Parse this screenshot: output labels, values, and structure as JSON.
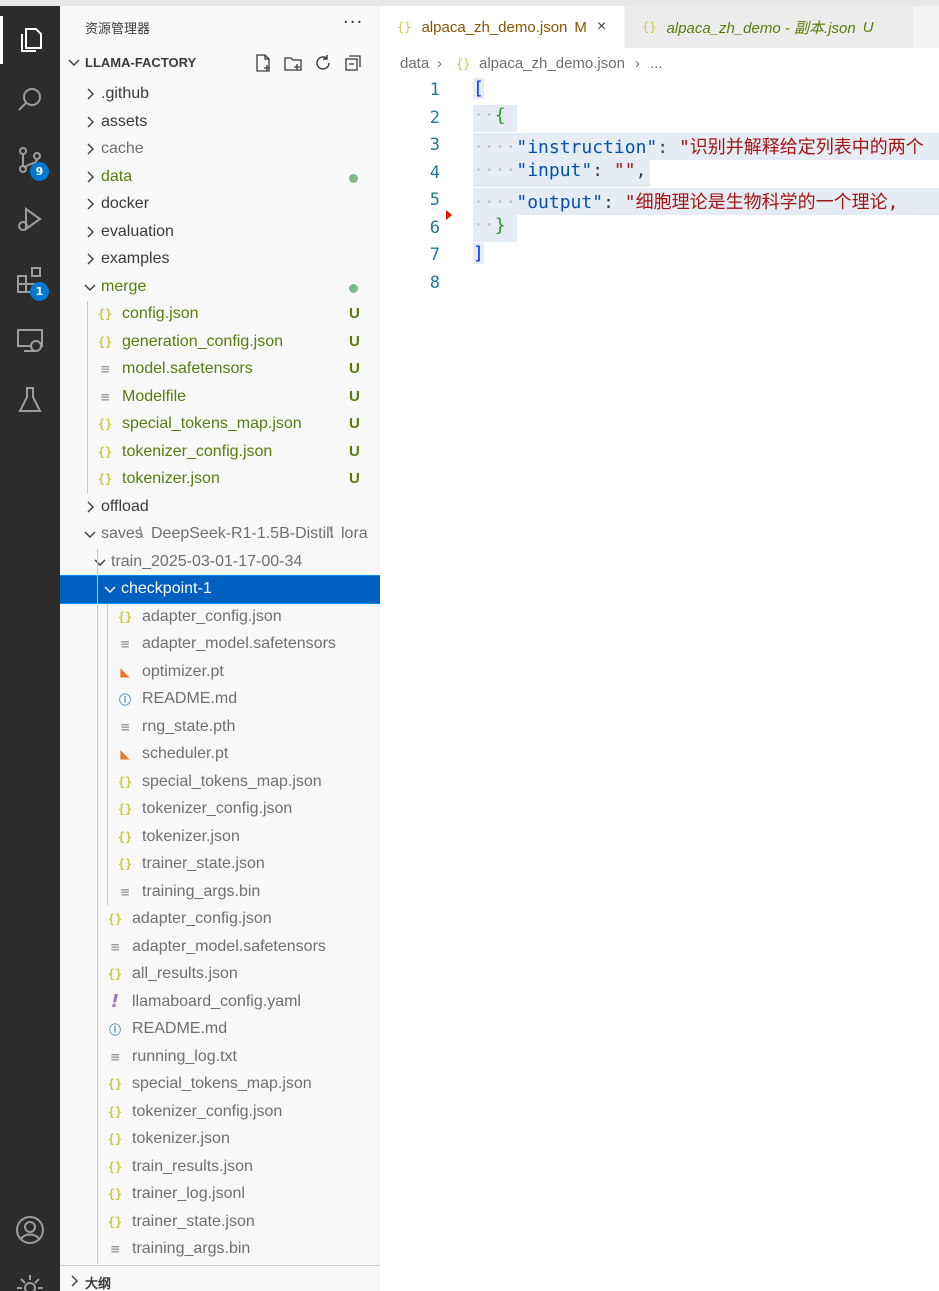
{
  "activity_bar": {
    "items": [
      {
        "name": "explorer-icon",
        "active": true
      },
      {
        "name": "search-icon"
      },
      {
        "name": "source-control-icon",
        "badge": "9"
      },
      {
        "name": "run-debug-icon"
      },
      {
        "name": "extensions-icon",
        "badge": "1"
      },
      {
        "name": "remote-explorer-icon"
      },
      {
        "name": "testing-icon"
      }
    ],
    "bottom": [
      {
        "name": "account-icon"
      },
      {
        "name": "settings-gear-icon"
      }
    ]
  },
  "sidebar": {
    "title": "资源管理器",
    "more": "···",
    "project": "LLAMA-FACTORY",
    "tree": [
      {
        "label": ".github",
        "type": "folder",
        "open": false
      },
      {
        "label": "assets",
        "type": "folder",
        "open": false
      },
      {
        "label": "cache",
        "type": "folder",
        "open": false
      },
      {
        "label": "data",
        "type": "folder",
        "open": false
      },
      {
        "label": "docker",
        "type": "folder",
        "open": false
      },
      {
        "label": "evaluation",
        "type": "folder",
        "open": false
      },
      {
        "label": "examples",
        "type": "folder",
        "open": false
      },
      {
        "label": "merge",
        "type": "folder",
        "open": true
      },
      {
        "label": "config.json",
        "type": "json",
        "status": "U"
      },
      {
        "label": "generation_config.json",
        "type": "json",
        "status": "U"
      },
      {
        "label": "model.safetensors",
        "type": "file",
        "status": "U"
      },
      {
        "label": "Modelfile",
        "type": "file",
        "status": "U"
      },
      {
        "label": "special_tokens_map.json",
        "type": "json",
        "status": "U"
      },
      {
        "label": "tokenizer_config.json",
        "type": "json",
        "status": "U"
      },
      {
        "label": "tokenizer.json",
        "type": "json",
        "status": "U"
      },
      {
        "label": "offload",
        "type": "folder",
        "open": false
      },
      {
        "label": "saves",
        "type": "folder",
        "open": true,
        "compact": [
          "DeepSeek-R1-1.5B-Distill",
          "lora"
        ]
      },
      {
        "label": "train_2025-03-01-17-00-34",
        "type": "folder",
        "open": true
      },
      {
        "label": "checkpoint-1",
        "type": "folder",
        "open": true,
        "selected": true
      },
      {
        "label": "adapter_config.json",
        "type": "json"
      },
      {
        "label": "adapter_model.safetensors",
        "type": "file"
      },
      {
        "label": "optimizer.pt",
        "type": "rss"
      },
      {
        "label": "README.md",
        "type": "info"
      },
      {
        "label": "rng_state.pth",
        "type": "file"
      },
      {
        "label": "scheduler.pt",
        "type": "rss"
      },
      {
        "label": "special_tokens_map.json",
        "type": "json"
      },
      {
        "label": "tokenizer_config.json",
        "type": "json"
      },
      {
        "label": "tokenizer.json",
        "type": "json"
      },
      {
        "label": "trainer_state.json",
        "type": "json"
      },
      {
        "label": "training_args.bin",
        "type": "file"
      },
      {
        "label": "adapter_config.json",
        "type": "json"
      },
      {
        "label": "adapter_model.safetensors",
        "type": "file"
      },
      {
        "label": "all_results.json",
        "type": "json"
      },
      {
        "label": "llamaboard_config.yaml",
        "type": "yaml"
      },
      {
        "label": "README.md",
        "type": "info"
      },
      {
        "label": "running_log.txt",
        "type": "file"
      },
      {
        "label": "special_tokens_map.json",
        "type": "json"
      },
      {
        "label": "tokenizer_config.json",
        "type": "json"
      },
      {
        "label": "tokenizer.json",
        "type": "json"
      },
      {
        "label": "train_results.json",
        "type": "json"
      },
      {
        "label": "trainer_log.jsonl",
        "type": "json"
      },
      {
        "label": "trainer_state.json",
        "type": "json"
      },
      {
        "label": "training_args.bin",
        "type": "file"
      }
    ],
    "outline_label": "大纲"
  },
  "tabs": [
    {
      "label": "alpaca_zh_demo.json",
      "status": "M",
      "active": true,
      "close": "×"
    },
    {
      "label": "alpaca_zh_demo - 副本.json",
      "status": "U",
      "active": false
    }
  ],
  "breadcrumb": {
    "folder": "data",
    "file": "alpaca_zh_demo.json",
    "more": "..."
  },
  "editor": {
    "line_numbers": [
      "1",
      "2",
      "3",
      "4",
      "5",
      "6",
      "7",
      "8"
    ],
    "json_icon": "{}",
    "code": {
      "open_bracket": "[",
      "open_brace": "{",
      "key_instruction": "\"instruction\"",
      "val_instruction": "\"识别并解释给定列表中的两个",
      "key_input": "\"input\"",
      "val_input": "\"\"",
      "key_output": "\"output\"",
      "val_output": "\"细胞理论是生物科学的一个理论,",
      "close_brace": "}",
      "close_bracket": "]"
    }
  }
}
